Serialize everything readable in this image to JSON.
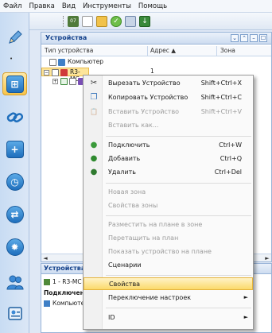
{
  "menubar": {
    "items": [
      "Файл",
      "Правка",
      "Вид",
      "Инструменты",
      "Помощь"
    ]
  },
  "sidebar": {
    "more_label": "•"
  },
  "devices_panel": {
    "title": "Устройства",
    "header_buttons": [
      "⌄",
      "⌃",
      "–",
      "☐"
    ],
    "columns": [
      "Тип устройства",
      "Адрес ▲",
      "Зона"
    ],
    "rows": [
      {
        "label": "Компьютер",
        "address": ""
      },
      {
        "label": "R3-MC",
        "address": "1"
      },
      {
        "label": "",
        "address": "2"
      }
    ],
    "scroll_left": "◄",
    "scroll_right": "►"
  },
  "bottom_panel": {
    "title": "Устройства: E",
    "line1": "1 - R3-MC с",
    "line2": "Подключено",
    "line3": "Компьютер"
  },
  "context_menu": {
    "items": [
      {
        "label": "Вырезать Устройство",
        "shortcut": "Shift+Ctrl+X",
        "enabled": true,
        "icon": "scissors-icon",
        "glyph": "✂"
      },
      {
        "label": "Копировать Устройство",
        "shortcut": "Shift+Ctrl+C",
        "enabled": true,
        "icon": "copy-icon",
        "glyph": "❐"
      },
      {
        "label": "Вставить Устройство",
        "shortcut": "Shift+Ctrl+V",
        "enabled": false,
        "icon": "paste-icon",
        "glyph": "📋"
      },
      {
        "label": "Вставить как...",
        "shortcut": "",
        "enabled": false,
        "icon": "",
        "glyph": ""
      },
      {
        "label": "Подключить",
        "shortcut": "Ctrl+W",
        "enabled": true,
        "icon": "connect-icon",
        "glyph": "●"
      },
      {
        "label": "Добавить",
        "shortcut": "Ctrl+Q",
        "enabled": true,
        "icon": "add-icon",
        "glyph": "●"
      },
      {
        "label": "Удалить",
        "shortcut": "Ctrl+Del",
        "enabled": true,
        "icon": "delete-icon",
        "glyph": "●"
      },
      {
        "label": "Новая зона",
        "shortcut": "",
        "enabled": false
      },
      {
        "label": "Свойства зоны",
        "shortcut": "",
        "enabled": false
      },
      {
        "label": "Разместить на плане в зоне",
        "shortcut": "",
        "enabled": false
      },
      {
        "label": "Перетащить на план",
        "shortcut": "",
        "enabled": false
      },
      {
        "label": "Показать устройство на плане",
        "shortcut": "",
        "enabled": false
      },
      {
        "label": "Сценарии",
        "shortcut": "",
        "enabled": true
      },
      {
        "label": "Свойства",
        "shortcut": "",
        "enabled": true
      },
      {
        "label": "Переключение настроек",
        "shortcut": "",
        "enabled": true,
        "submenu": "►"
      },
      {
        "label": "ID",
        "shortcut": "",
        "enabled": true,
        "submenu": "►"
      }
    ]
  },
  "colors": {
    "accent": "#15428b",
    "highlight": "#fbd96a",
    "selection": "#fde59a"
  }
}
